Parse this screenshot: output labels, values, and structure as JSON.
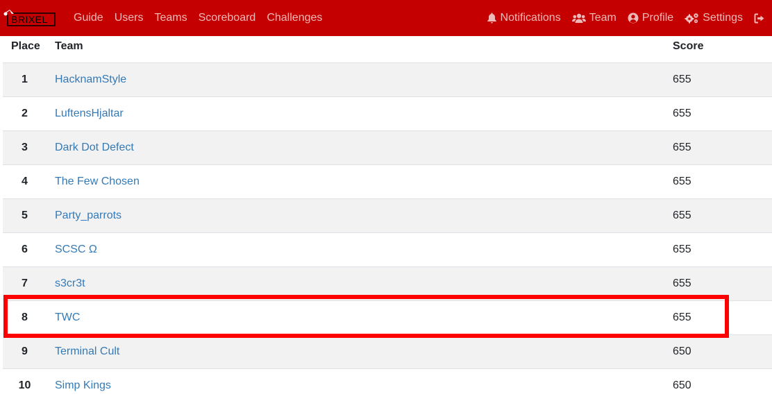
{
  "brand": {
    "text": "BRIXEL"
  },
  "nav": {
    "left": [
      {
        "label": "Guide"
      },
      {
        "label": "Users"
      },
      {
        "label": "Teams"
      },
      {
        "label": "Scoreboard"
      },
      {
        "label": "Challenges"
      }
    ],
    "right": [
      {
        "label": "Notifications",
        "icon": "bell-icon"
      },
      {
        "label": "Team",
        "icon": "users-icon"
      },
      {
        "label": "Profile",
        "icon": "user-circle-icon"
      },
      {
        "label": "Settings",
        "icon": "cogs-icon"
      }
    ],
    "logout_icon": "sign-out-icon"
  },
  "scoreboard": {
    "headers": {
      "place": "Place",
      "team": "Team",
      "score": "Score"
    },
    "rows": [
      {
        "place": "1",
        "team": "HacknamStyle",
        "score": "655"
      },
      {
        "place": "2",
        "team": "LuftensHjaltar",
        "score": "655"
      },
      {
        "place": "3",
        "team": "Dark Dot Defect",
        "score": "655"
      },
      {
        "place": "4",
        "team": "The Few Chosen",
        "score": "655"
      },
      {
        "place": "5",
        "team": "Party_parrots",
        "score": "655"
      },
      {
        "place": "6",
        "team": "SCSC Ω",
        "score": "655"
      },
      {
        "place": "7",
        "team": "s3cr3t",
        "score": "655"
      },
      {
        "place": "8",
        "team": "TWC",
        "score": "655"
      },
      {
        "place": "9",
        "team": "Terminal Cult",
        "score": "650"
      },
      {
        "place": "10",
        "team": "Simp Kings",
        "score": "650"
      }
    ]
  },
  "colors": {
    "navbar": "#c40000",
    "link": "#337ab7",
    "highlight": "#ff0000",
    "row_stripe": "#f2f2f2"
  }
}
